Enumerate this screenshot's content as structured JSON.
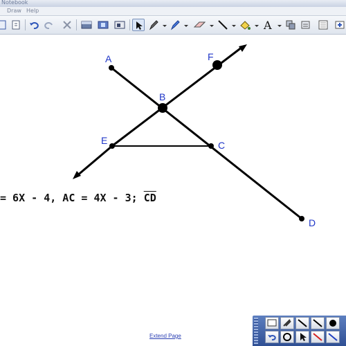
{
  "window": {
    "title": "Notebook"
  },
  "menu": {
    "items": [
      "Draw",
      "Help"
    ]
  },
  "toolbar": {
    "icons": [
      "page-icon",
      "open-icon",
      "undo-icon",
      "redo-icon",
      "delete-icon",
      "screen-shade-icon",
      "capture-icon",
      "insert-icon",
      "select-arrow-icon",
      "pen-icon",
      "creative-pen-icon",
      "eraser-icon",
      "line-icon",
      "fill-icon",
      "text-icon",
      "properties-icon",
      "move-toolbar-icon"
    ]
  },
  "diagram": {
    "points": {
      "A": "A",
      "B": "B",
      "C": "C",
      "D": "D",
      "E": "E",
      "F": "F"
    },
    "line_color": "#000000",
    "label_color": "#1f36c8"
  },
  "equation": {
    "text_main": "= 6X - 4, AC = 4X - 3; ",
    "segment": "CD"
  },
  "extend_page": "Extend Page",
  "floating_toolbar": {
    "icons": [
      "screen-icon",
      "pen-settings-icon",
      "line-tool-icon",
      "line-tool-2-icon",
      "fill-circle-icon",
      "undo-small-icon",
      "circle-tool-icon",
      "pointer-icon",
      "red-pen-icon",
      "blue-pen-icon"
    ]
  }
}
